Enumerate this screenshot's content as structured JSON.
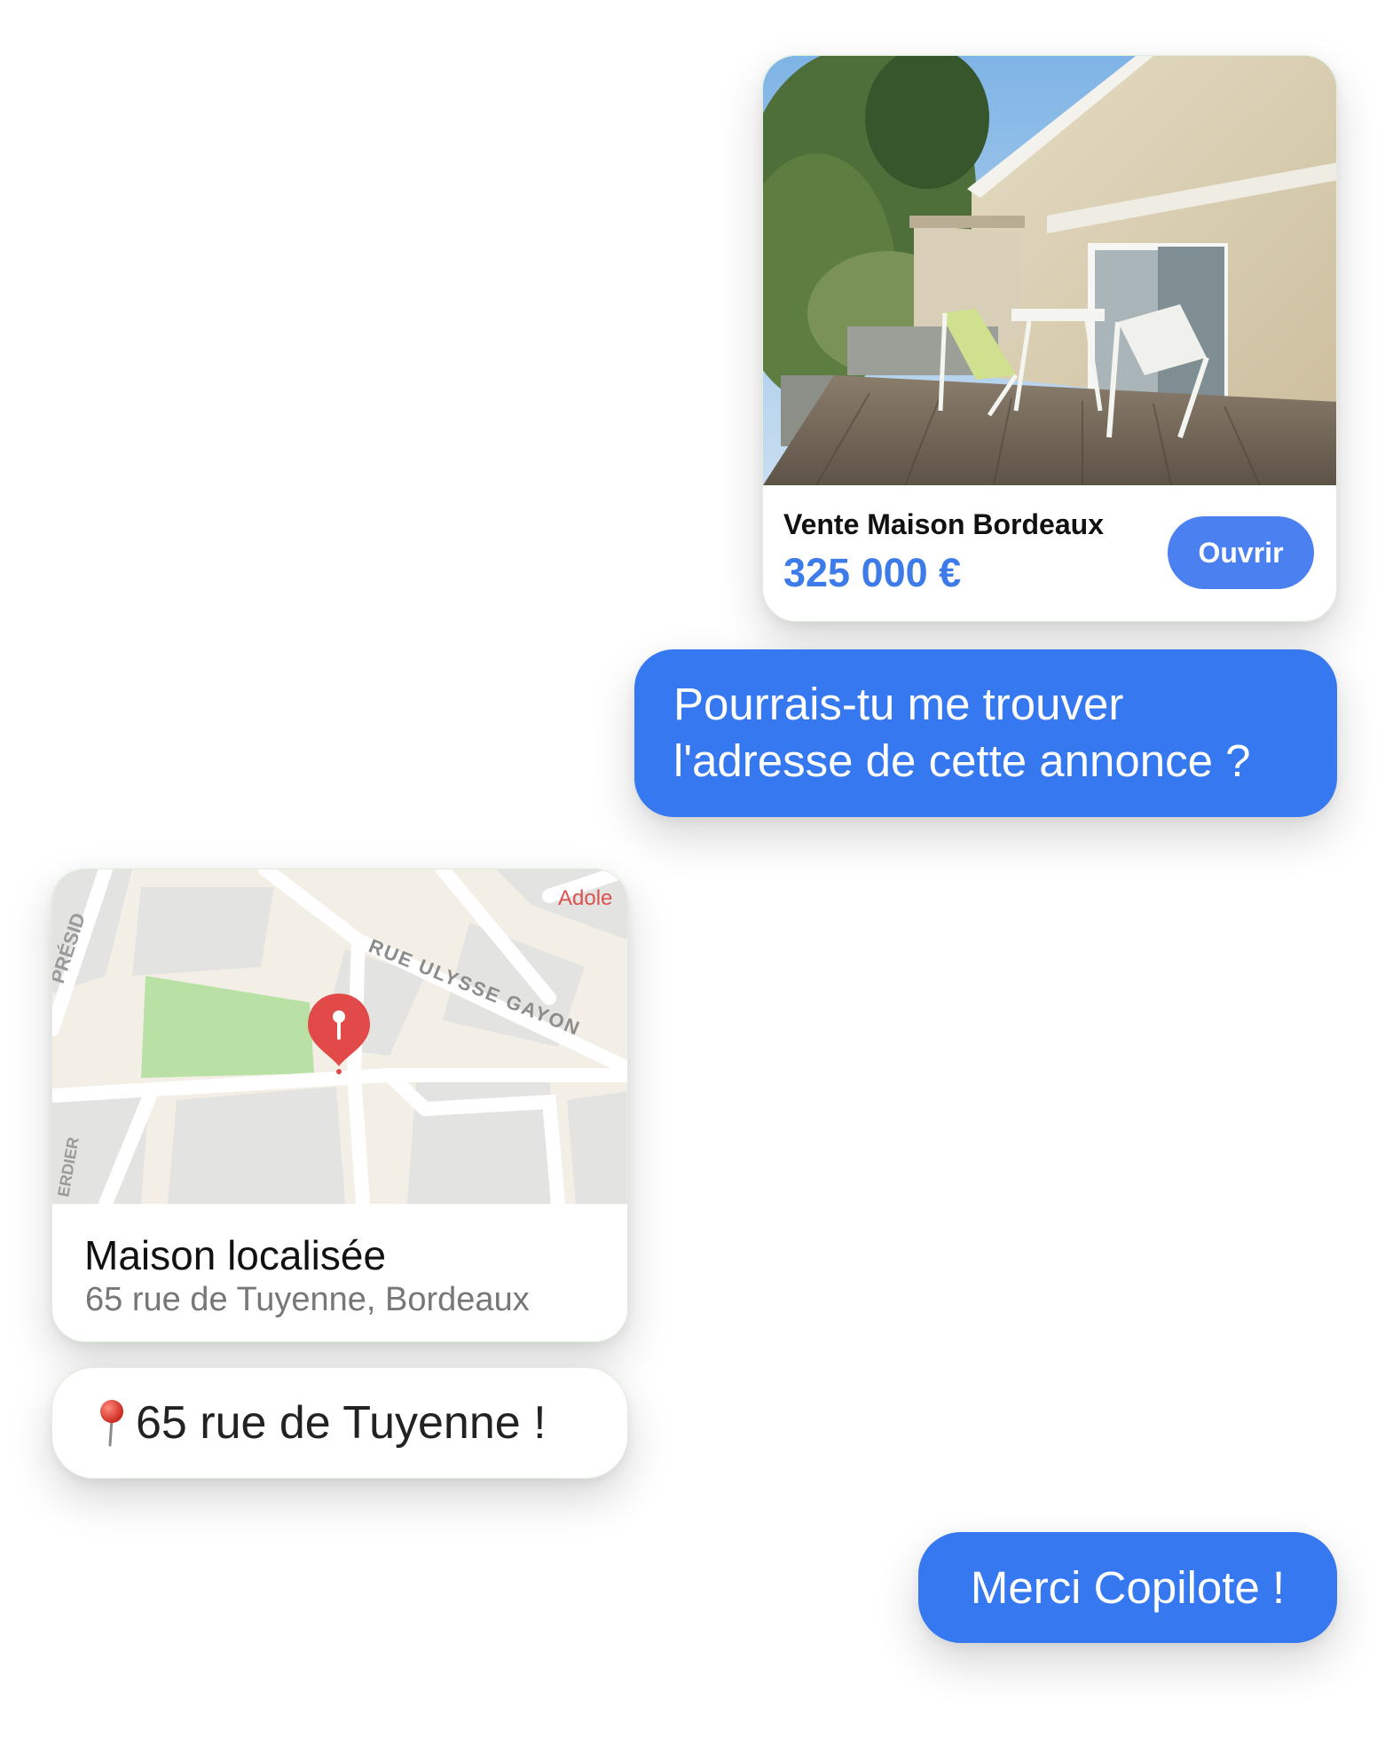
{
  "listing": {
    "title": "Vente Maison Bordeaux",
    "price": "325 000 €",
    "open_label": "Ouvrir",
    "photo_icon": "house-terrace-photo"
  },
  "messages": {
    "question_line1": "Pourrais-tu me trouver",
    "question_line2": "l'adresse de cette annonce ?",
    "reply_text": "65 rue de Tuyenne !",
    "reply_icon": "round-pushpin-icon",
    "thanks": "Merci Copilote !"
  },
  "map_card": {
    "title": "Maison localisée",
    "address": "65 rue de Tuyenne, Bordeaux",
    "street_labels": [
      "RUE ULYSSE GAYON",
      "Adole",
      "PRÉSID",
      "ERDIER"
    ],
    "pin_icon": "map-marker-icon"
  },
  "colors": {
    "accent_blue": "#3578ef",
    "button_blue": "#4b80f0",
    "price_blue": "#3c7be8",
    "pin_red": "#e24a4a",
    "park_green": "#b9e0a5"
  }
}
